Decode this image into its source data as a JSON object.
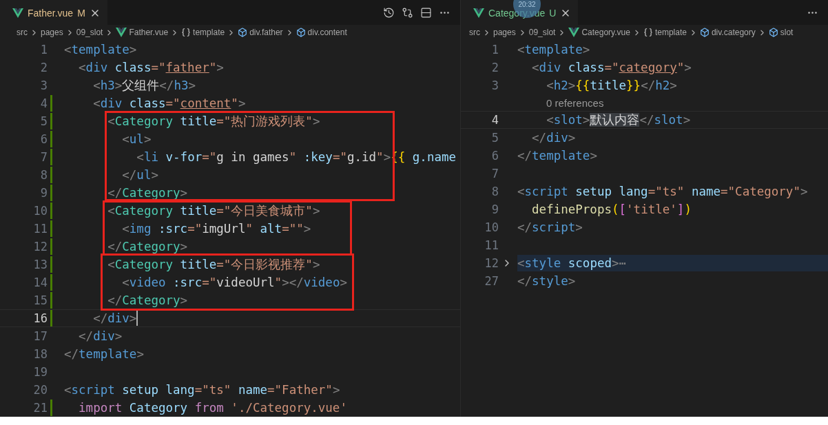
{
  "video_timestamp": "20:32",
  "panes": [
    {
      "focused": true,
      "tab": {
        "label": "Father.vue",
        "status": "M"
      },
      "actions": [
        {
          "kind": "history"
        },
        {
          "kind": "compare"
        },
        {
          "kind": "split"
        },
        {
          "kind": "more"
        }
      ],
      "breadcrumb": [
        {
          "text": "src",
          "kind": "folder"
        },
        {
          "text": "pages",
          "kind": "folder"
        },
        {
          "text": "09_slot",
          "kind": "folder"
        },
        {
          "text": "Father.vue",
          "kind": "vue"
        },
        {
          "text": "template",
          "kind": "braces"
        },
        {
          "text": "div.father",
          "kind": "element"
        },
        {
          "text": "div.content",
          "kind": "element"
        }
      ],
      "lines": [
        {
          "kind": "code",
          "number": "1",
          "changed": false,
          "current": false,
          "folded": false,
          "tokens": [
            {
              "text": "<",
              "kind": "p"
            },
            {
              "text": "template",
              "kind": "tag"
            },
            {
              "text": ">",
              "kind": "p"
            }
          ]
        },
        {
          "kind": "code",
          "number": "2",
          "changed": false,
          "current": false,
          "folded": false,
          "tokens": [
            {
              "text": "  <",
              "kind": "p"
            },
            {
              "text": "div",
              "kind": "tag"
            },
            {
              "text": " class",
              "kind": "attr"
            },
            {
              "text": "=\"",
              "kind": "str"
            },
            {
              "text": "father",
              "kind": "cls"
            },
            {
              "text": "\"",
              "kind": "str"
            },
            {
              "text": ">",
              "kind": "p"
            }
          ]
        },
        {
          "kind": "code",
          "number": "3",
          "changed": false,
          "current": false,
          "folded": false,
          "tokens": [
            {
              "text": "    <",
              "kind": "p"
            },
            {
              "text": "h3",
              "kind": "tag"
            },
            {
              "text": ">",
              "kind": "p"
            },
            {
              "text": "父组件",
              "kind": "text"
            },
            {
              "text": "</",
              "kind": "p"
            },
            {
              "text": "h3",
              "kind": "tag"
            },
            {
              "text": ">",
              "kind": "p"
            }
          ]
        },
        {
          "kind": "code",
          "number": "4",
          "changed": true,
          "current": false,
          "folded": false,
          "tokens": [
            {
              "text": "    <",
              "kind": "p"
            },
            {
              "text": "div",
              "kind": "tag"
            },
            {
              "text": " class",
              "kind": "attr"
            },
            {
              "text": "=\"",
              "kind": "str"
            },
            {
              "text": "content",
              "kind": "cls"
            },
            {
              "text": "\"",
              "kind": "str"
            },
            {
              "text": ">",
              "kind": "p"
            }
          ]
        },
        {
          "kind": "code",
          "number": "5",
          "changed": true,
          "current": false,
          "folded": false,
          "tokens": [
            {
              "text": "      <",
              "kind": "p"
            },
            {
              "text": "Category",
              "kind": "comp"
            },
            {
              "text": " title",
              "kind": "attr"
            },
            {
              "text": "=\"热门游戏列表\"",
              "kind": "str"
            },
            {
              "text": ">",
              "kind": "p"
            }
          ]
        },
        {
          "kind": "code",
          "number": "6",
          "changed": true,
          "current": false,
          "folded": false,
          "tokens": [
            {
              "text": "        <",
              "kind": "p"
            },
            {
              "text": "ul",
              "kind": "tag"
            },
            {
              "text": ">",
              "kind": "p"
            }
          ]
        },
        {
          "kind": "code",
          "number": "7",
          "changed": true,
          "current": false,
          "folded": false,
          "tokens": [
            {
              "text": "          <",
              "kind": "p"
            },
            {
              "text": "li",
              "kind": "tag"
            },
            {
              "text": " v-for",
              "kind": "attr"
            },
            {
              "text": "=\"",
              "kind": "str"
            },
            {
              "text": "g in games",
              "kind": "text"
            },
            {
              "text": "\"",
              "kind": "str"
            },
            {
              "text": " :key",
              "kind": "attr"
            },
            {
              "text": "=\"",
              "kind": "str"
            },
            {
              "text": "g.id",
              "kind": "text"
            },
            {
              "text": "\"",
              "kind": "str"
            },
            {
              "text": ">",
              "kind": "p"
            },
            {
              "text": "{{",
              "kind": "brace"
            },
            {
              "text": " g.name",
              "kind": "attr"
            }
          ]
        },
        {
          "kind": "code",
          "number": "8",
          "changed": true,
          "current": false,
          "folded": false,
          "tokens": [
            {
              "text": "        </",
              "kind": "p"
            },
            {
              "text": "ul",
              "kind": "tag"
            },
            {
              "text": ">",
              "kind": "p"
            }
          ]
        },
        {
          "kind": "code",
          "number": "9",
          "changed": true,
          "current": false,
          "folded": false,
          "tokens": [
            {
              "text": "      </",
              "kind": "p"
            },
            {
              "text": "Category",
              "kind": "comp"
            },
            {
              "text": ">",
              "kind": "p"
            }
          ]
        },
        {
          "kind": "code",
          "number": "10",
          "changed": true,
          "current": false,
          "folded": false,
          "tokens": [
            {
              "text": "      <",
              "kind": "p"
            },
            {
              "text": "Category",
              "kind": "comp"
            },
            {
              "text": " title",
              "kind": "attr"
            },
            {
              "text": "=\"今日美食城市\"",
              "kind": "str"
            },
            {
              "text": ">",
              "kind": "p"
            }
          ]
        },
        {
          "kind": "code",
          "number": "11",
          "changed": true,
          "current": false,
          "folded": false,
          "tokens": [
            {
              "text": "        <",
              "kind": "p"
            },
            {
              "text": "img",
              "kind": "tag"
            },
            {
              "text": " :src",
              "kind": "attr"
            },
            {
              "text": "=\"",
              "kind": "str"
            },
            {
              "text": "imgUrl",
              "kind": "text"
            },
            {
              "text": "\"",
              "kind": "str"
            },
            {
              "text": " alt",
              "kind": "attr"
            },
            {
              "text": "=\"\"",
              "kind": "str"
            },
            {
              "text": ">",
              "kind": "p"
            }
          ]
        },
        {
          "kind": "code",
          "number": "12",
          "changed": true,
          "current": false,
          "folded": false,
          "tokens": [
            {
              "text": "      </",
              "kind": "p"
            },
            {
              "text": "Category",
              "kind": "comp"
            },
            {
              "text": ">",
              "kind": "p"
            }
          ]
        },
        {
          "kind": "code",
          "number": "13",
          "changed": true,
          "current": false,
          "folded": false,
          "tokens": [
            {
              "text": "      <",
              "kind": "p"
            },
            {
              "text": "Category",
              "kind": "comp"
            },
            {
              "text": " title",
              "kind": "attr"
            },
            {
              "text": "=\"今日影视推荐\"",
              "kind": "str"
            },
            {
              "text": ">",
              "kind": "p"
            }
          ]
        },
        {
          "kind": "code",
          "number": "14",
          "changed": true,
          "current": false,
          "folded": false,
          "tokens": [
            {
              "text": "        <",
              "kind": "p"
            },
            {
              "text": "video",
              "kind": "tag"
            },
            {
              "text": " :src",
              "kind": "attr"
            },
            {
              "text": "=\"",
              "kind": "str"
            },
            {
              "text": "videoUrl",
              "kind": "text"
            },
            {
              "text": "\"",
              "kind": "str"
            },
            {
              "text": "></",
              "kind": "p"
            },
            {
              "text": "video",
              "kind": "tag"
            },
            {
              "text": ">",
              "kind": "p"
            }
          ]
        },
        {
          "kind": "code",
          "number": "15",
          "changed": true,
          "current": false,
          "folded": false,
          "tokens": [
            {
              "text": "      </",
              "kind": "p"
            },
            {
              "text": "Category",
              "kind": "comp"
            },
            {
              "text": ">",
              "kind": "p"
            }
          ]
        },
        {
          "kind": "code",
          "number": "16",
          "changed": true,
          "current": true,
          "folded": false,
          "tokens": [
            {
              "text": "    </",
              "kind": "p"
            },
            {
              "text": "div",
              "kind": "tag"
            },
            {
              "text": ">",
              "kind": "p"
            }
          ]
        },
        {
          "kind": "code",
          "number": "17",
          "changed": false,
          "current": false,
          "folded": false,
          "tokens": [
            {
              "text": "  </",
              "kind": "p"
            },
            {
              "text": "div",
              "kind": "tag"
            },
            {
              "text": ">",
              "kind": "p"
            }
          ]
        },
        {
          "kind": "code",
          "number": "18",
          "changed": false,
          "current": false,
          "folded": false,
          "tokens": [
            {
              "text": "</",
              "kind": "p"
            },
            {
              "text": "template",
              "kind": "tag"
            },
            {
              "text": ">",
              "kind": "p"
            }
          ]
        },
        {
          "kind": "code",
          "number": "19",
          "changed": false,
          "current": false,
          "folded": false
        },
        {
          "kind": "code",
          "number": "20",
          "changed": false,
          "current": false,
          "folded": false,
          "tokens": [
            {
              "text": "<",
              "kind": "p"
            },
            {
              "text": "script",
              "kind": "tag"
            },
            {
              "text": " setup lang",
              "kind": "attr"
            },
            {
              "text": "=\"ts\"",
              "kind": "str"
            },
            {
              "text": " name",
              "kind": "attr"
            },
            {
              "text": "=\"Father\"",
              "kind": "str"
            },
            {
              "text": ">",
              "kind": "p"
            }
          ]
        },
        {
          "kind": "code",
          "number": "21",
          "changed": true,
          "current": false,
          "folded": false,
          "tokens": [
            {
              "text": "  import",
              "kind": "kw"
            },
            {
              "text": " Category ",
              "kind": "attr"
            },
            {
              "text": "from",
              "kind": "kw"
            },
            {
              "text": " './Category.vue'",
              "kind": "str"
            }
          ]
        }
      ]
    },
    {
      "focused": false,
      "tab": {
        "label": "Category.vue",
        "status": "U"
      },
      "actions": [
        {
          "kind": "more"
        }
      ],
      "breadcrumb": [
        {
          "text": "src",
          "kind": "folder"
        },
        {
          "text": "pages",
          "kind": "folder"
        },
        {
          "text": "09_slot",
          "kind": "folder"
        },
        {
          "text": "Category.vue",
          "kind": "vue"
        },
        {
          "text": "template",
          "kind": "braces"
        },
        {
          "text": "div.category",
          "kind": "element"
        },
        {
          "text": "slot",
          "kind": "element"
        }
      ],
      "lines": [
        {
          "kind": "code",
          "number": "1",
          "changed": false,
          "current": false,
          "folded": false,
          "tokens": [
            {
              "text": "<",
              "kind": "p"
            },
            {
              "text": "template",
              "kind": "tag"
            },
            {
              "text": ">",
              "kind": "p"
            }
          ]
        },
        {
          "kind": "code",
          "number": "2",
          "changed": false,
          "current": false,
          "folded": false,
          "tokens": [
            {
              "text": "  <",
              "kind": "p"
            },
            {
              "text": "div",
              "kind": "tag"
            },
            {
              "text": " class",
              "kind": "attr"
            },
            {
              "text": "=\"",
              "kind": "str"
            },
            {
              "text": "category",
              "kind": "cls"
            },
            {
              "text": "\"",
              "kind": "str"
            },
            {
              "text": ">",
              "kind": "p"
            }
          ]
        },
        {
          "kind": "code",
          "number": "3",
          "changed": false,
          "current": false,
          "folded": false,
          "tokens": [
            {
              "text": "    <",
              "kind": "p"
            },
            {
              "text": "h2",
              "kind": "tag"
            },
            {
              "text": ">",
              "kind": "p"
            },
            {
              "text": "{{",
              "kind": "brace"
            },
            {
              "text": "title",
              "kind": "attr"
            },
            {
              "text": "}}",
              "kind": "brace"
            },
            {
              "text": "</",
              "kind": "p"
            },
            {
              "text": "h2",
              "kind": "tag"
            },
            {
              "text": ">",
              "kind": "p"
            }
          ]
        },
        {
          "kind": "codelens",
          "text": "0 references"
        },
        {
          "kind": "code",
          "number": "4",
          "changed": false,
          "current": true,
          "folded": false,
          "tokens": [
            {
              "text": "    <",
              "kind": "p"
            },
            {
              "text": "slot",
              "kind": "tag"
            },
            {
              "text": ">",
              "kind": "p"
            },
            {
              "text": "默认内容",
              "kind": "sel"
            },
            {
              "text": "</",
              "kind": "p"
            },
            {
              "text": "slot",
              "kind": "tag"
            },
            {
              "text": ">",
              "kind": "p"
            }
          ]
        },
        {
          "kind": "code",
          "number": "5",
          "changed": false,
          "current": false,
          "folded": false,
          "tokens": [
            {
              "text": "  </",
              "kind": "p"
            },
            {
              "text": "div",
              "kind": "tag"
            },
            {
              "text": ">",
              "kind": "p"
            }
          ]
        },
        {
          "kind": "code",
          "number": "6",
          "changed": false,
          "current": false,
          "folded": false,
          "tokens": [
            {
              "text": "</",
              "kind": "p"
            },
            {
              "text": "template",
              "kind": "tag"
            },
            {
              "text": ">",
              "kind": "p"
            }
          ]
        },
        {
          "kind": "code",
          "number": "7",
          "changed": false,
          "current": false,
          "folded": false
        },
        {
          "kind": "code",
          "number": "8",
          "changed": false,
          "current": false,
          "folded": false,
          "tokens": [
            {
              "text": "<",
              "kind": "p"
            },
            {
              "text": "script",
              "kind": "tag"
            },
            {
              "text": " setup lang",
              "kind": "attr"
            },
            {
              "text": "=\"ts\"",
              "kind": "str"
            },
            {
              "text": " name",
              "kind": "attr"
            },
            {
              "text": "=\"Category\"",
              "kind": "str"
            },
            {
              "text": ">",
              "kind": "p"
            }
          ]
        },
        {
          "kind": "code",
          "number": "9",
          "changed": false,
          "current": false,
          "folded": false,
          "tokens": [
            {
              "text": "  defineProps",
              "kind": "fn"
            },
            {
              "text": "(",
              "kind": "brace"
            },
            {
              "text": "[",
              "kind": "bracket"
            },
            {
              "text": "'title'",
              "kind": "str"
            },
            {
              "text": "]",
              "kind": "bracket"
            },
            {
              "text": ")",
              "kind": "brace"
            }
          ]
        },
        {
          "kind": "code",
          "number": "10",
          "changed": false,
          "current": false,
          "folded": false,
          "tokens": [
            {
              "text": "</",
              "kind": "p"
            },
            {
              "text": "script",
              "kind": "tag"
            },
            {
              "text": ">",
              "kind": "p"
            }
          ]
        },
        {
          "kind": "code",
          "number": "11",
          "changed": false,
          "current": false,
          "folded": false
        },
        {
          "kind": "code",
          "number": "12",
          "changed": false,
          "current": false,
          "folded": true,
          "tokens": [
            {
              "text": "<",
              "kind": "p"
            },
            {
              "text": "style",
              "kind": "tag"
            },
            {
              "text": " scoped",
              "kind": "attr"
            },
            {
              "text": ">",
              "kind": "p"
            },
            {
              "text": "⋯",
              "kind": "p"
            }
          ]
        },
        {
          "kind": "code",
          "number": "27",
          "changed": false,
          "current": false,
          "folded": false,
          "tokens": [
            {
              "text": "</",
              "kind": "p"
            },
            {
              "text": "style",
              "kind": "tag"
            },
            {
              "text": ">",
              "kind": "p"
            }
          ]
        }
      ]
    }
  ]
}
